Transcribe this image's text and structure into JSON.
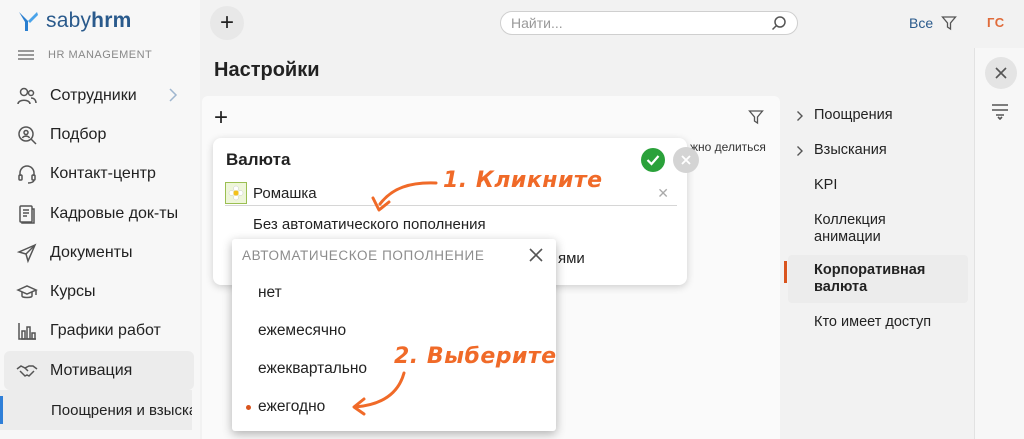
{
  "app": {
    "logo_text_light": "saby",
    "logo_text_bold": "hrm",
    "section_label": "HR MANAGEMENT"
  },
  "sidebar": {
    "items": [
      {
        "label": "Сотрудники",
        "icon": "people-icon"
      },
      {
        "label": "Подбор",
        "icon": "search-person-icon"
      },
      {
        "label": "Контакт-центр",
        "icon": "headset-icon"
      },
      {
        "label": "Кадровые док-ты",
        "icon": "document-icon"
      },
      {
        "label": "Документы",
        "icon": "send-icon"
      },
      {
        "label": "Курсы",
        "icon": "mortarboard-icon"
      },
      {
        "label": "Графики работ",
        "icon": "bar-chart-icon"
      },
      {
        "label": "Мотивация",
        "icon": "handshake-icon"
      }
    ],
    "sub_item": "Поощрения и взыскания"
  },
  "topbar": {
    "search_placeholder": "Найти...",
    "filter_label": "Все",
    "user_initials": "ГС"
  },
  "page": {
    "title": "Настройки",
    "background_fragment": "жно делиться",
    "background_fragment2": "ями"
  },
  "right_nav": {
    "items": [
      {
        "label": "Поощрения",
        "expandable": true
      },
      {
        "label": "Взыскания",
        "expandable": true
      },
      {
        "label": "KPI",
        "expandable": false
      },
      {
        "label": "Коллекция анимации",
        "expandable": false
      },
      {
        "label": "Корпоративная валюта",
        "expandable": false,
        "active": true
      },
      {
        "label": "Кто имеет доступ",
        "expandable": false
      }
    ]
  },
  "card": {
    "title": "Валюта",
    "currency_name": "Ромашка",
    "replenishment": "Без автоматического пополнения"
  },
  "dropdown": {
    "header": "АВТОМАТИЧЕСКОЕ ПОПОЛНЕНИЕ",
    "options": [
      "нет",
      "ежемесячно",
      "ежеквартально",
      "ежегодно"
    ],
    "selected_index": 3
  },
  "annotations": {
    "step1": "1. Кликните",
    "step2": "2. Выберите"
  },
  "colors": {
    "accent": "#f06a28",
    "brand": "#2a5a8c",
    "ok": "#2aa13a",
    "active_marker": "#d9541e"
  }
}
